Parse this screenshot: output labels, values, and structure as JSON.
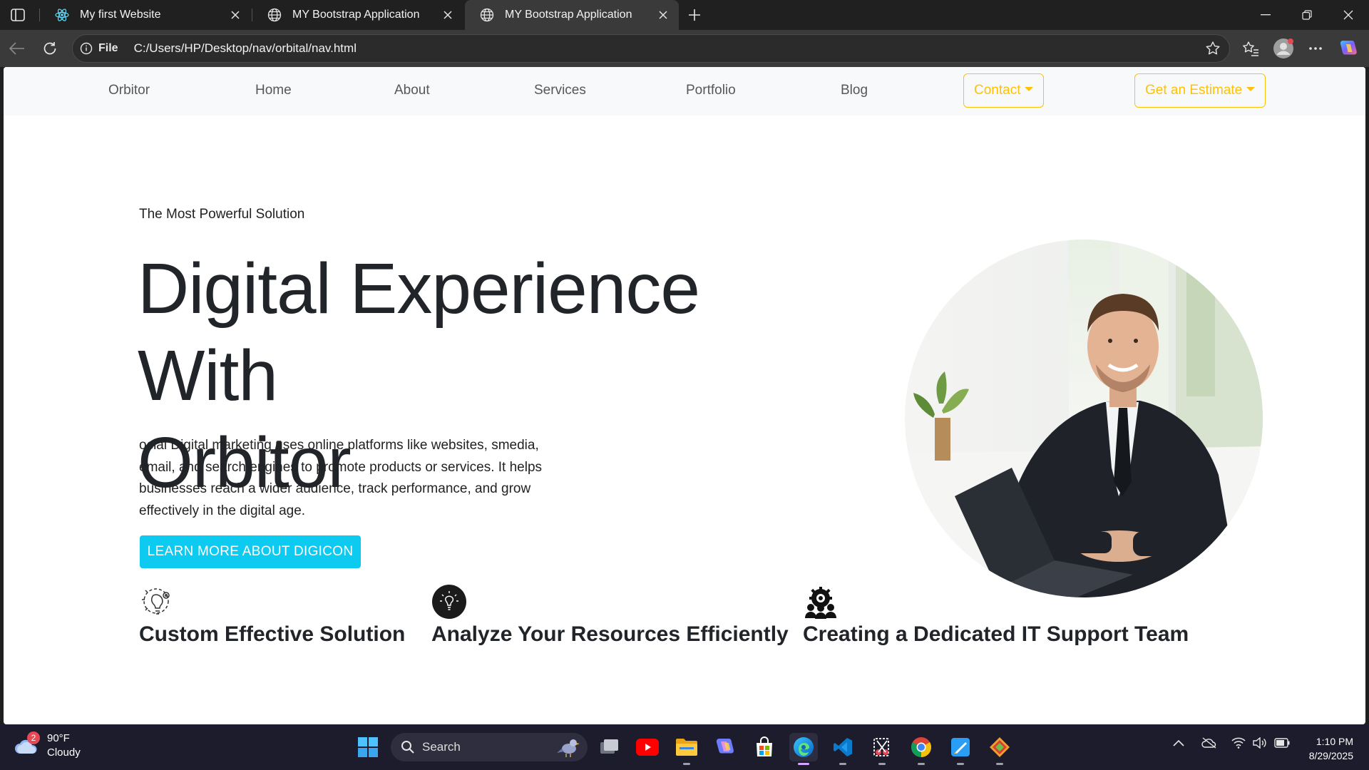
{
  "browser": {
    "tabs": [
      {
        "title": "My first Website",
        "active": false
      },
      {
        "title": "MY Bootstrap Application",
        "active": false
      },
      {
        "title": "MY Bootstrap Application",
        "active": true
      }
    ],
    "address": {
      "info_label": "File",
      "url": "C:/Users/HP/Desktop/nav/orbital/nav.html"
    }
  },
  "navbar": {
    "brand": "Orbitor",
    "links": [
      "Home",
      "About",
      "Services",
      "Portfolio",
      "Blog"
    ],
    "dropdowns": [
      "Contact",
      "Get an Estimate"
    ],
    "accent_color": "#ffc107"
  },
  "hero": {
    "eyebrow": "The Most Powerful Solution",
    "title_line1": "Digital Experience With",
    "title_line2": "Orbitor",
    "paragraph": "ocial Digital marketing uses online platforms like websites, smedia, email, and search engines to promote products or services. It helps businesses reach a wider audience, track performance, and grow effectively in the digital age.",
    "cta_label": "LEARN MORE ABOUT DIGICON",
    "cta_color": "#0dcaf0"
  },
  "features": [
    {
      "icon": "lightbulb-gear-icon",
      "title": "Custom Effective Solution"
    },
    {
      "icon": "lightbulb-circle-icon",
      "title": "Analyze Your Resources Efficiently"
    },
    {
      "icon": "team-gear-icon",
      "title": "Creating a Dedicated IT Support Team"
    }
  ],
  "taskbar": {
    "weather": {
      "temp": "90°F",
      "condition": "Cloudy",
      "badge": "2"
    },
    "search_placeholder": "Search",
    "time": "1:10 PM",
    "date": "8/29/2025"
  }
}
